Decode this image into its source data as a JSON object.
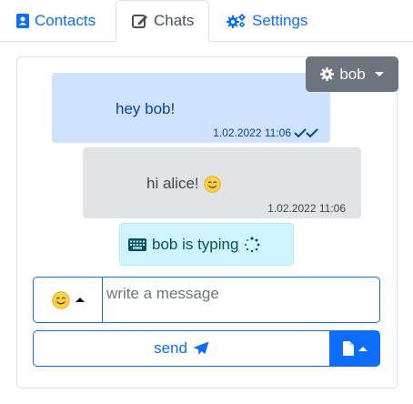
{
  "tabs": {
    "contacts_label": "Contacts",
    "chats_label": "Chats",
    "settings_label": "Settings"
  },
  "user_menu": {
    "label": "bob"
  },
  "messages": [
    {
      "text": "hey bob!",
      "timestamp": "1.02.2022 11:06",
      "status_icon": "double-check-icon"
    },
    {
      "text": "hi alice!",
      "emoji": "smiling-face-icon",
      "timestamp": "1.02.2022 11:06"
    }
  ],
  "typing_indicator": {
    "text": "bob is typing",
    "icon": "keyboard-icon"
  },
  "composer": {
    "placeholder": "write a message",
    "value": "",
    "send_label": "send",
    "emoji_icon": "smiling-face-icon",
    "file_icon": "file-icon"
  },
  "colors": {
    "primary": "#0d6efd",
    "secondary": "#6c757d",
    "sent_bubble": "#cfe2ff",
    "received_bubble": "#e2e3e5",
    "typing_bubble": "#cff4fc"
  }
}
